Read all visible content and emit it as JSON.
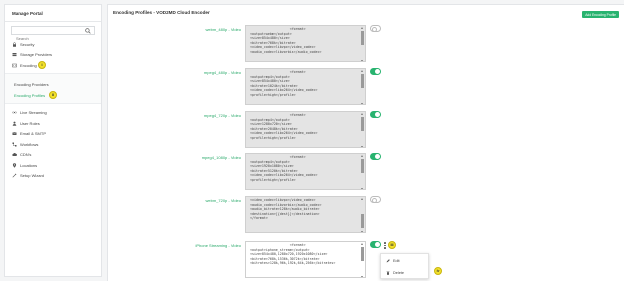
{
  "sidebar": {
    "title": "Manage Portal",
    "search_placeholder": "Search",
    "items": [
      {
        "label": "Security"
      },
      {
        "label": "Storage Providers"
      },
      {
        "label": "Encoding"
      }
    ],
    "encoding_sub": [
      {
        "label": "Encoding Providers"
      },
      {
        "label": "Encoding Profiles"
      }
    ],
    "items_after": [
      {
        "label": "Live Streaming"
      },
      {
        "label": "User Roles"
      },
      {
        "label": "Email & SMTP"
      },
      {
        "label": "Workflows"
      },
      {
        "label": "CDN's"
      },
      {
        "label": "Locations"
      },
      {
        "label": "Setup Wizard"
      }
    ]
  },
  "markers": {
    "encoding": "i",
    "profiles": "ii",
    "toggle": "iii",
    "delete": "iv"
  },
  "main": {
    "title": "Encoding Profiles - VOD2MD Cloud Encoder",
    "add_button": "Add Encoding Profile"
  },
  "profiles": [
    {
      "label": "webm_480p - Video",
      "enabled": false,
      "code": "                    <format>\n<output>webm</output>\n<size>854x480</size>\n<bitrate>768k</bitrate>\n<video_codec>libvpx</video_codec>\n<audio_codec>libvorbis</audio_codec>"
    },
    {
      "label": "mpeg4_480p - Video",
      "enabled": true,
      "code": "                    <format>\n<output>mp4</output>\n<size>854x480</size>\n<bitrate>1024k</bitrate>\n<video_codec>libx264</video_codec>\n<profile>high</profile>"
    },
    {
      "label": "mpeg4_720p - Video",
      "enabled": true,
      "code": "                    <format>\n<output>mp4</output>\n<size>1280x720</size>\n<bitrate>2048k</bitrate>\n<video_codec>libx264</video_codec>\n<profile>high</profile>"
    },
    {
      "label": "mpeg4_1080p - Video",
      "enabled": true,
      "code": "                    <format>\n<output>mp4</output>\n<size>1920x1080</size>\n<bitrate>5120k</bitrate>\n<video_codec>libx264</video_codec>\n<profile>high</profile>"
    },
    {
      "label": "webm_720p - Video",
      "enabled": false,
      "code": "<video_codec>libvpx</video_codec>\n<audio_codec>libvorbis</audio_codec>\n<audio_bitrate>128k</audio_bitrate>\n<destination>[{dest}]</destination>\n</format>"
    },
    {
      "label": "iPhone Streaming - Video",
      "enabled": true,
      "code": "                    <format>\n<output>iphone_stream</output>\n<size>854x480,1280x720,1920x1080</size>\n<bitrate>768k,1536k,3072k</bitrate>\n<bitrates>128k,96k,192k,64k,256k</bitrates>"
    }
  ],
  "context_menu": {
    "edit": "Edit",
    "delete": "Delete"
  },
  "colors": {
    "accent": "#28b36f",
    "marker": "#f2e12b"
  }
}
